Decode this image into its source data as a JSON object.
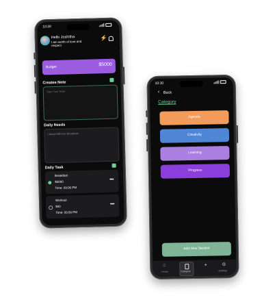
{
  "phone_left": {
    "status_time": "10:30",
    "greeting": "Hello Joshitha",
    "affirmation_line1": "I am worth of love and",
    "affirmation_line2": "respect",
    "budget_label": "Budget",
    "budget_amount": "$5000",
    "create_note_title": "Creates Note",
    "note_placeholder": "Type Your Note",
    "daily_needs_title": "Daily Needs",
    "daily_needs_placeholder": "I Need Milk For  Breakfast",
    "daily_task_title": "Daily Task",
    "tasks": [
      {
        "name": "Breakfast",
        "amount": "$5000",
        "time": "Time: 09:00 PM"
      },
      {
        "name": "Workout",
        "amount": "$00",
        "time": "Time: 09:00 PM"
      }
    ],
    "colors": {
      "budget": "#9b5ce0"
    }
  },
  "phone_right": {
    "status_time": "10:30",
    "back_label": "Back",
    "category_title": "Category",
    "categories": [
      {
        "label": "Agenda",
        "color": "#f29b5a"
      },
      {
        "label": "Creativity",
        "color": "#4f86d6"
      },
      {
        "label": "Learning",
        "color": "#a97fe0"
      },
      {
        "label": "Progress",
        "color": "#8a3fdc"
      }
    ],
    "add_section_label": "Add New Section",
    "nav": [
      {
        "label": "Home",
        "icon": "home-icon"
      },
      {
        "label": "Category",
        "icon": "clipboard-icon"
      },
      {
        "label": "",
        "icon": "sparkle-icon"
      },
      {
        "label": "Settings",
        "icon": "gear-icon"
      }
    ],
    "colors": {
      "category_title": "#6fcf97",
      "add_section": "#7fb596"
    }
  }
}
